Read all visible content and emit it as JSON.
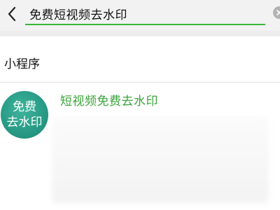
{
  "search": {
    "query": "免费短视频去水印"
  },
  "section": {
    "title": "小程序"
  },
  "result": {
    "name": "短视频免费去水印",
    "logo_line1": "免费",
    "logo_line2": "去水印"
  },
  "colors": {
    "accent_green": "#1aad19",
    "result_title": "#3aa33a",
    "logo_teal": "#21937f"
  },
  "icons": {
    "back": "chevron-left-icon",
    "clear": "clear-circle-icon"
  }
}
